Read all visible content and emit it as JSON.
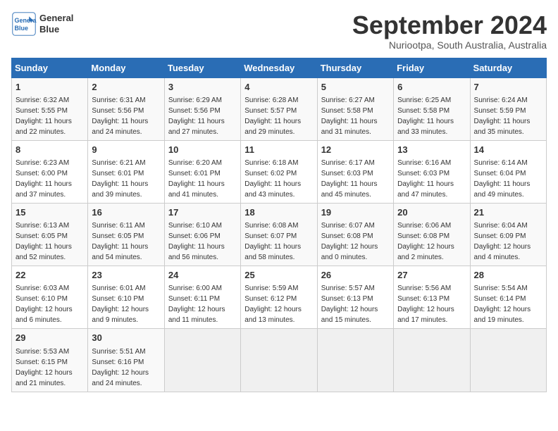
{
  "header": {
    "logo_line1": "General",
    "logo_line2": "Blue",
    "month": "September 2024",
    "location": "Nuriootpa, South Australia, Australia"
  },
  "days_of_week": [
    "Sunday",
    "Monday",
    "Tuesday",
    "Wednesday",
    "Thursday",
    "Friday",
    "Saturday"
  ],
  "weeks": [
    [
      {
        "day": "1",
        "sunrise": "6:32 AM",
        "sunset": "5:55 PM",
        "daylight": "11 hours and 22 minutes."
      },
      {
        "day": "2",
        "sunrise": "6:31 AM",
        "sunset": "5:56 PM",
        "daylight": "11 hours and 24 minutes."
      },
      {
        "day": "3",
        "sunrise": "6:29 AM",
        "sunset": "5:56 PM",
        "daylight": "11 hours and 27 minutes."
      },
      {
        "day": "4",
        "sunrise": "6:28 AM",
        "sunset": "5:57 PM",
        "daylight": "11 hours and 29 minutes."
      },
      {
        "day": "5",
        "sunrise": "6:27 AM",
        "sunset": "5:58 PM",
        "daylight": "11 hours and 31 minutes."
      },
      {
        "day": "6",
        "sunrise": "6:25 AM",
        "sunset": "5:58 PM",
        "daylight": "11 hours and 33 minutes."
      },
      {
        "day": "7",
        "sunrise": "6:24 AM",
        "sunset": "5:59 PM",
        "daylight": "11 hours and 35 minutes."
      }
    ],
    [
      {
        "day": "8",
        "sunrise": "6:23 AM",
        "sunset": "6:00 PM",
        "daylight": "11 hours and 37 minutes."
      },
      {
        "day": "9",
        "sunrise": "6:21 AM",
        "sunset": "6:01 PM",
        "daylight": "11 hours and 39 minutes."
      },
      {
        "day": "10",
        "sunrise": "6:20 AM",
        "sunset": "6:01 PM",
        "daylight": "11 hours and 41 minutes."
      },
      {
        "day": "11",
        "sunrise": "6:18 AM",
        "sunset": "6:02 PM",
        "daylight": "11 hours and 43 minutes."
      },
      {
        "day": "12",
        "sunrise": "6:17 AM",
        "sunset": "6:03 PM",
        "daylight": "11 hours and 45 minutes."
      },
      {
        "day": "13",
        "sunrise": "6:16 AM",
        "sunset": "6:03 PM",
        "daylight": "11 hours and 47 minutes."
      },
      {
        "day": "14",
        "sunrise": "6:14 AM",
        "sunset": "6:04 PM",
        "daylight": "11 hours and 49 minutes."
      }
    ],
    [
      {
        "day": "15",
        "sunrise": "6:13 AM",
        "sunset": "6:05 PM",
        "daylight": "11 hours and 52 minutes."
      },
      {
        "day": "16",
        "sunrise": "6:11 AM",
        "sunset": "6:05 PM",
        "daylight": "11 hours and 54 minutes."
      },
      {
        "day": "17",
        "sunrise": "6:10 AM",
        "sunset": "6:06 PM",
        "daylight": "11 hours and 56 minutes."
      },
      {
        "day": "18",
        "sunrise": "6:08 AM",
        "sunset": "6:07 PM",
        "daylight": "11 hours and 58 minutes."
      },
      {
        "day": "19",
        "sunrise": "6:07 AM",
        "sunset": "6:08 PM",
        "daylight": "12 hours and 0 minutes."
      },
      {
        "day": "20",
        "sunrise": "6:06 AM",
        "sunset": "6:08 PM",
        "daylight": "12 hours and 2 minutes."
      },
      {
        "day": "21",
        "sunrise": "6:04 AM",
        "sunset": "6:09 PM",
        "daylight": "12 hours and 4 minutes."
      }
    ],
    [
      {
        "day": "22",
        "sunrise": "6:03 AM",
        "sunset": "6:10 PM",
        "daylight": "12 hours and 6 minutes."
      },
      {
        "day": "23",
        "sunrise": "6:01 AM",
        "sunset": "6:10 PM",
        "daylight": "12 hours and 9 minutes."
      },
      {
        "day": "24",
        "sunrise": "6:00 AM",
        "sunset": "6:11 PM",
        "daylight": "12 hours and 11 minutes."
      },
      {
        "day": "25",
        "sunrise": "5:59 AM",
        "sunset": "6:12 PM",
        "daylight": "12 hours and 13 minutes."
      },
      {
        "day": "26",
        "sunrise": "5:57 AM",
        "sunset": "6:13 PM",
        "daylight": "12 hours and 15 minutes."
      },
      {
        "day": "27",
        "sunrise": "5:56 AM",
        "sunset": "6:13 PM",
        "daylight": "12 hours and 17 minutes."
      },
      {
        "day": "28",
        "sunrise": "5:54 AM",
        "sunset": "6:14 PM",
        "daylight": "12 hours and 19 minutes."
      }
    ],
    [
      {
        "day": "29",
        "sunrise": "5:53 AM",
        "sunset": "6:15 PM",
        "daylight": "12 hours and 21 minutes."
      },
      {
        "day": "30",
        "sunrise": "5:51 AM",
        "sunset": "6:16 PM",
        "daylight": "12 hours and 24 minutes."
      },
      null,
      null,
      null,
      null,
      null
    ]
  ]
}
